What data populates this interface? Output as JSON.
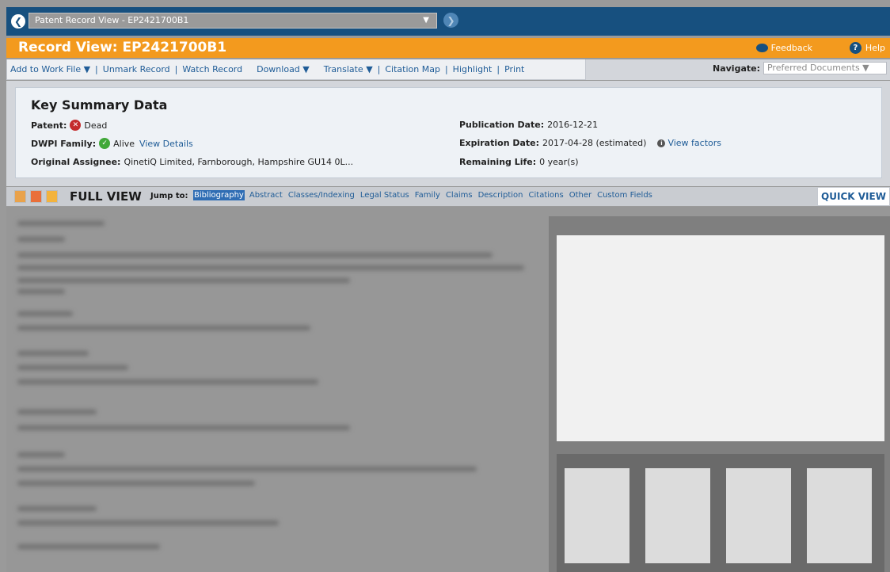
{
  "topbar": {
    "record_select": "Patent Record View - EP2421700B1",
    "select_arrow": "▼"
  },
  "titlebar": {
    "title": "Record View: EP2421700B1",
    "feedback": "Feedback",
    "help": "Help"
  },
  "toolbar": {
    "items": [
      "Add to Work File ▼",
      "Unmark Record",
      "Watch Record",
      "Download ▼",
      "Translate ▼",
      "Citation Map",
      "Highlight",
      "Print"
    ],
    "navigate_label": "Navigate:",
    "navigate_value": "Preferred Documents ▼"
  },
  "summary": {
    "heading": "Key Summary Data",
    "patent_label": "Patent:",
    "patent_value": "Dead",
    "dwpi_label": "DWPI Family:",
    "dwpi_value": "Alive",
    "dwpi_link": "View Details",
    "assignee_label": "Original Assignee:",
    "assignee_value": "QinetiQ Limited, Farnborough, Hampshire GU14 0L...",
    "pub_label": "Publication Date:",
    "pub_value": "2016-12-21",
    "exp_label": "Expiration Date:",
    "exp_value": "2017-04-28 (estimated)",
    "exp_link": "View factors",
    "life_label": "Remaining Life:",
    "life_value": "0 year(s)"
  },
  "fullview": {
    "label": "FULL VIEW",
    "jump_label": "Jump to:",
    "links": [
      "Bibliography",
      "Abstract",
      "Classes/Indexing",
      "Legal Status",
      "Family",
      "Claims",
      "Description",
      "Citations",
      "Other",
      "Custom Fields"
    ],
    "quick_view": "QUICK VIEW"
  },
  "icons": {
    "back": "arrow-left-icon",
    "forward": "arrow-right-icon",
    "feedback": "speech-bubble-icon",
    "help": "question-icon",
    "dead": "x-circle-icon",
    "alive": "check-circle-icon",
    "info": "info-icon"
  },
  "colors": {
    "topbar": "#17507f",
    "titlebar": "#f39a1e",
    "link": "#1f5c97"
  }
}
